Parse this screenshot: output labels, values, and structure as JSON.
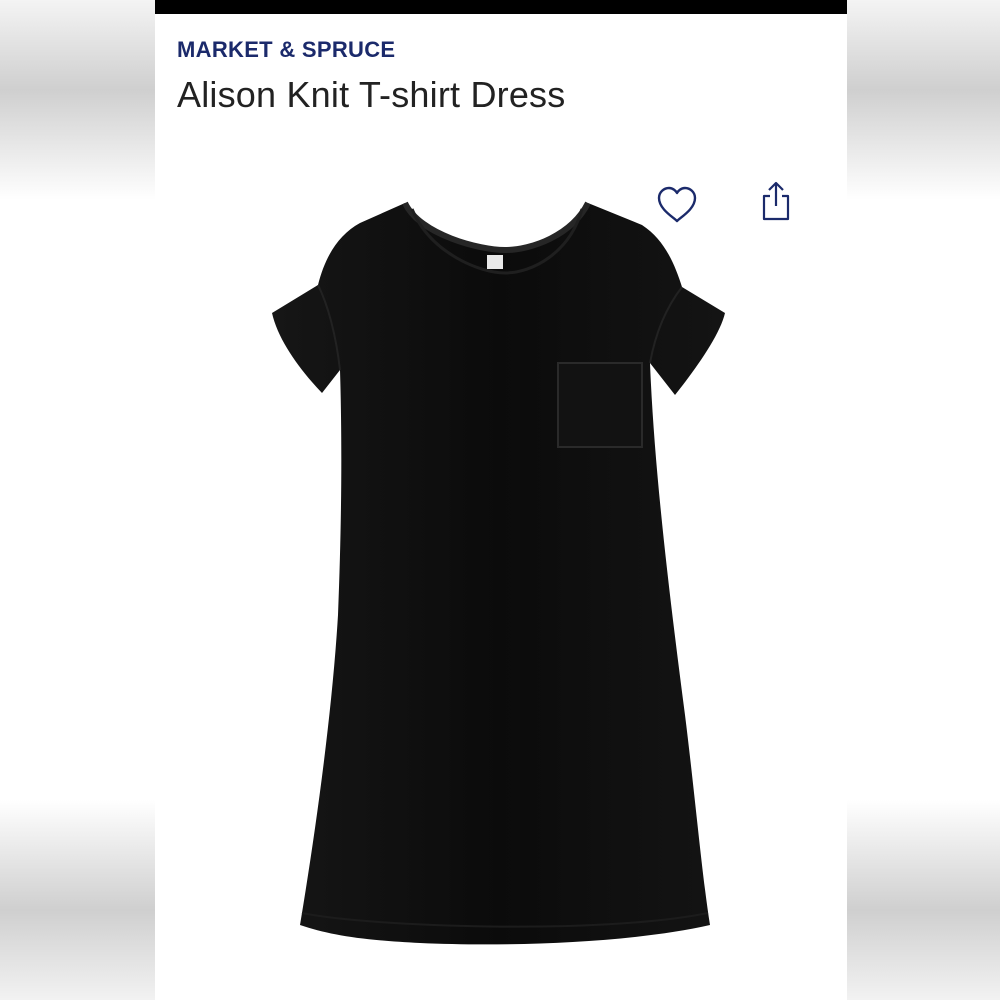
{
  "product": {
    "brand": "MARKET & SPRUCE",
    "name": "Alison Knit T-shirt Dress"
  },
  "icons": {
    "favorite": "heart-icon",
    "share": "share-icon"
  },
  "colors": {
    "brand_text": "#1b2a6b",
    "icon": "#1b2a6b",
    "product_fabric": "#0c0c0c"
  }
}
